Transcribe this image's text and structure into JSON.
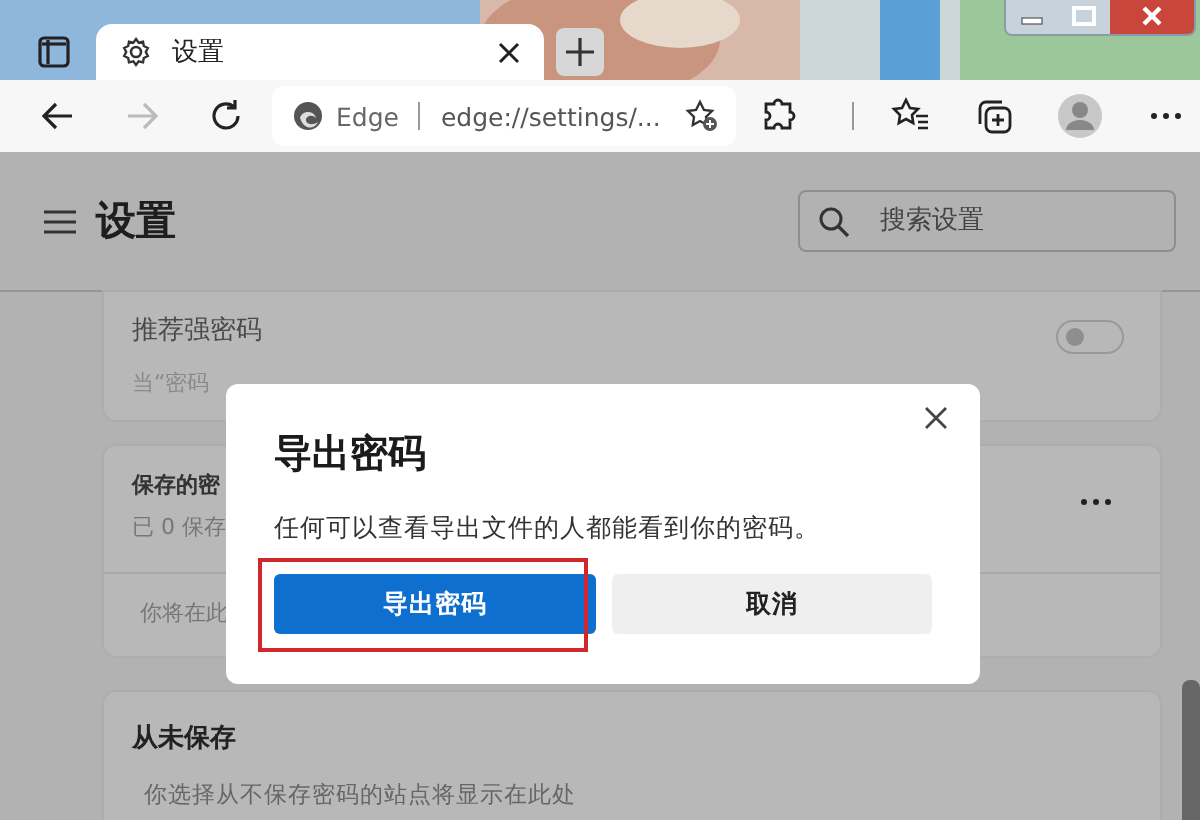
{
  "tabs": [
    {
      "label": "设置",
      "selected": true
    }
  ],
  "address": {
    "site": "Edge",
    "url": "edge://settings/..."
  },
  "header": {
    "title": "设置",
    "search": {
      "placeholder": "搜索设置"
    }
  },
  "cards": [
    {
      "title": "推荐强密码",
      "description": "当“密码",
      "toggle": {
        "on": false
      }
    },
    {
      "title": "保存的密",
      "subtitle": "已 0 保存",
      "body": "你将在此"
    },
    {
      "title": "从未保存",
      "body": "你选择从不保存密码的站点将显示在此处"
    }
  ],
  "dialog": {
    "title": "导出密码",
    "message": "任何可以查看导出文件的人都能看到你的密码。",
    "buttons": [
      {
        "label": "导出密码",
        "kind": "primary",
        "highlighted": true
      },
      {
        "label": "取消",
        "kind": "secondary",
        "highlighted": false
      }
    ]
  }
}
